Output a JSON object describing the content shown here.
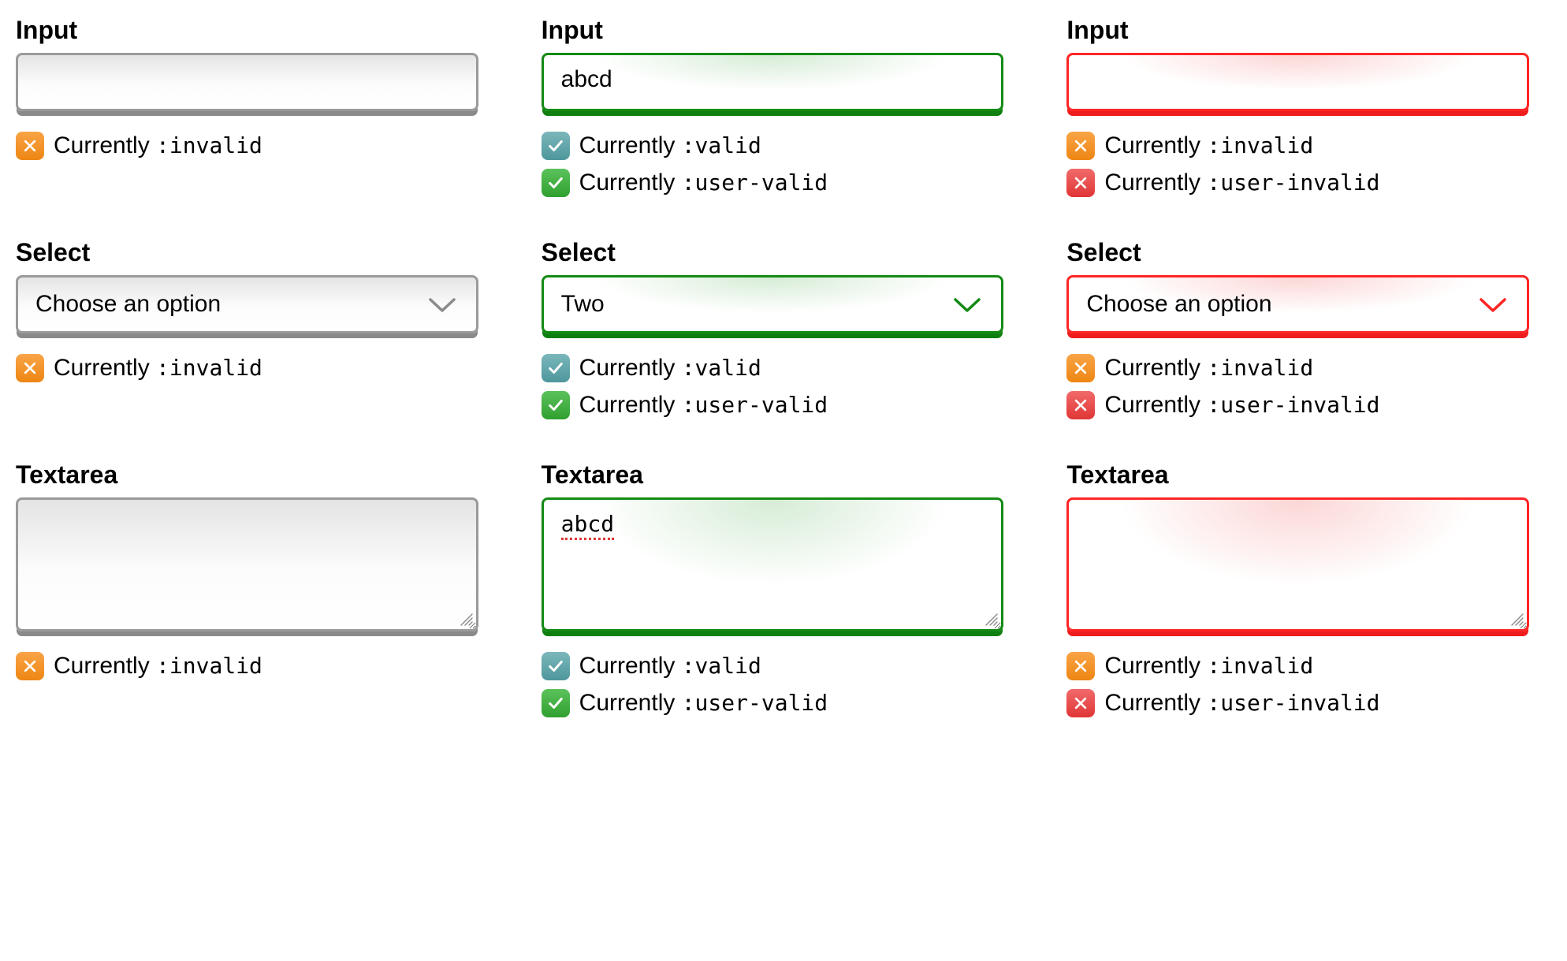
{
  "labels": {
    "input": "Input",
    "select": "Select",
    "textarea": "Textarea"
  },
  "status": {
    "currently": "Currently ",
    "invalid": ":invalid",
    "valid": ":valid",
    "user_valid": ":user-valid",
    "user_invalid": ":user-invalid"
  },
  "icons": {
    "cross": "cross",
    "check": "check"
  },
  "colors": {
    "gray": "#9a9a9a",
    "green": "#148a14",
    "red": "#ff2525"
  },
  "cells": [
    {
      "kind": "input",
      "state": "gray",
      "value": "",
      "statuses": [
        {
          "icon": "orange-cross",
          "code": "invalid"
        }
      ]
    },
    {
      "kind": "input",
      "state": "green",
      "value": "abcd",
      "statuses": [
        {
          "icon": "teal-check",
          "code": "valid"
        },
        {
          "icon": "green-check",
          "code": "user_valid"
        }
      ]
    },
    {
      "kind": "input",
      "state": "red",
      "value": "",
      "statuses": [
        {
          "icon": "orange-cross",
          "code": "invalid"
        },
        {
          "icon": "red-cross",
          "code": "user_invalid"
        }
      ]
    },
    {
      "kind": "select",
      "state": "gray",
      "value": "Choose an option",
      "statuses": [
        {
          "icon": "orange-cross",
          "code": "invalid"
        }
      ]
    },
    {
      "kind": "select",
      "state": "green",
      "value": "Two",
      "statuses": [
        {
          "icon": "teal-check",
          "code": "valid"
        },
        {
          "icon": "green-check",
          "code": "user_valid"
        }
      ]
    },
    {
      "kind": "select",
      "state": "red",
      "value": "Choose an option",
      "statuses": [
        {
          "icon": "orange-cross",
          "code": "invalid"
        },
        {
          "icon": "red-cross",
          "code": "user_invalid"
        }
      ]
    },
    {
      "kind": "textarea",
      "state": "gray",
      "value": "",
      "statuses": [
        {
          "icon": "orange-cross",
          "code": "invalid"
        }
      ]
    },
    {
      "kind": "textarea",
      "state": "green",
      "value": "abcd",
      "spellwave": true,
      "statuses": [
        {
          "icon": "teal-check",
          "code": "valid"
        },
        {
          "icon": "green-check",
          "code": "user_valid"
        }
      ]
    },
    {
      "kind": "textarea",
      "state": "red",
      "value": "",
      "statuses": [
        {
          "icon": "orange-cross",
          "code": "invalid"
        },
        {
          "icon": "red-cross",
          "code": "user_invalid"
        }
      ]
    }
  ]
}
